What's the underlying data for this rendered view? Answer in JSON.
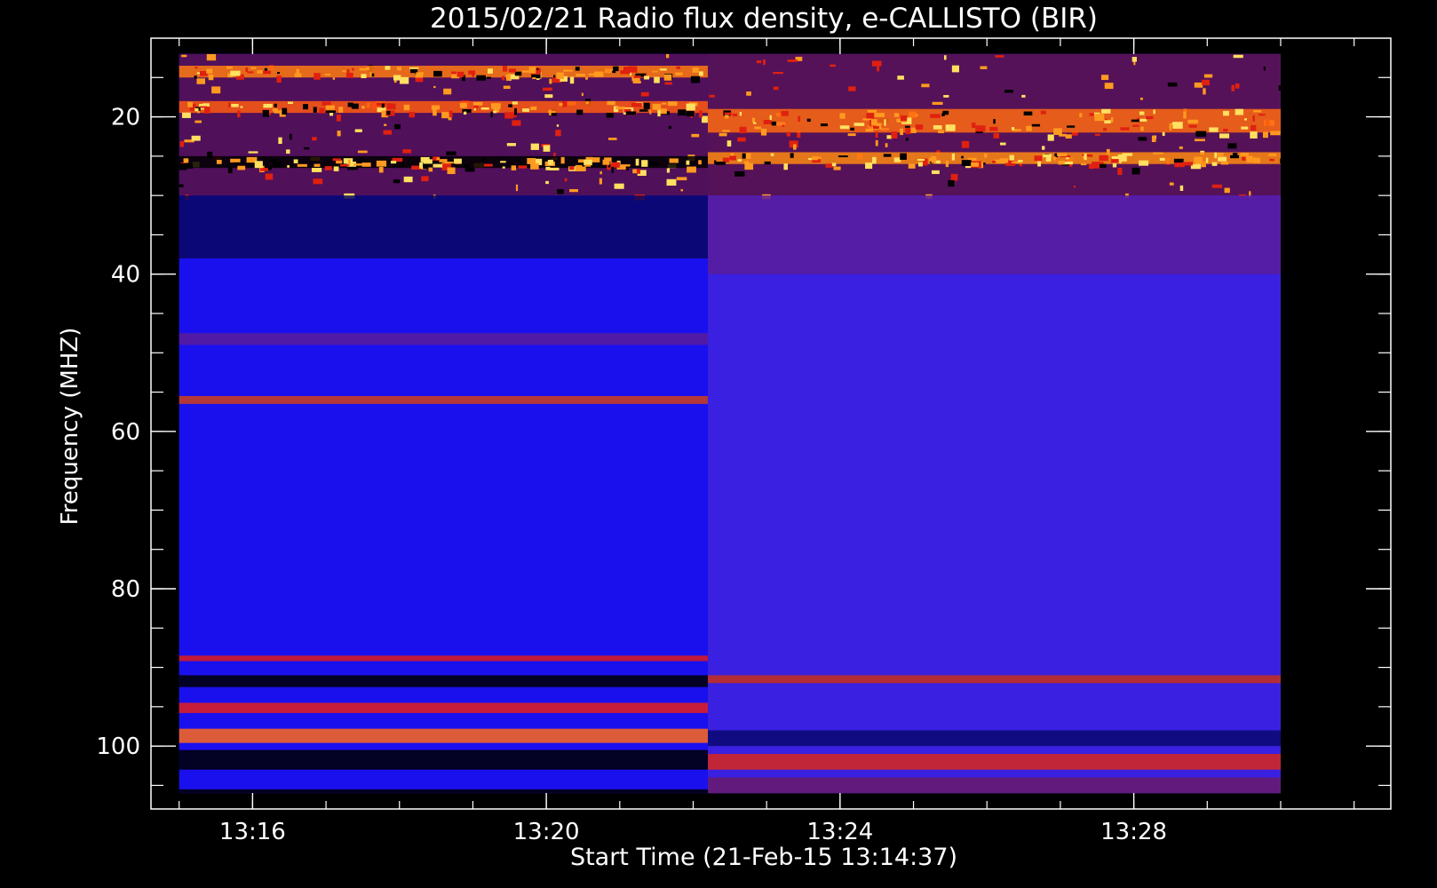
{
  "chart_data": {
    "type": "heatmap",
    "title": "2015/02/21  Radio flux density, e-CALLISTO (BIR)",
    "xlabel": "Start Time (21-Feb-15 13:14:37)",
    "ylabel": "Frequency (MHZ)",
    "x_range": [
      "13:14:37",
      "13:31:30"
    ],
    "y_range": [
      10,
      108
    ],
    "y_inverted": true,
    "data_time_range": [
      "13:15:00",
      "13:30:00"
    ],
    "data_freq_range": [
      12,
      106
    ],
    "x_ticks": [
      {
        "time": "13:16",
        "label": "13:16"
      },
      {
        "time": "13:20",
        "label": "13:20"
      },
      {
        "time": "13:24",
        "label": "13:24"
      },
      {
        "time": "13:28",
        "label": "13:28"
      }
    ],
    "x_minor_step_min": 1,
    "y_ticks": [
      {
        "value": 20,
        "label": "20"
      },
      {
        "value": 40,
        "label": "40"
      },
      {
        "value": 60,
        "label": "60"
      },
      {
        "value": 80,
        "label": "80"
      },
      {
        "value": 100,
        "label": "100"
      }
    ],
    "y_minor_step": 5,
    "switch_time": "13:22:12",
    "segments": [
      {
        "start": "13:15:00",
        "end": "13:22:12",
        "base_color": "#1a10ee",
        "bands": [
          {
            "f0": 12,
            "f1": 30,
            "color": "#5a1040",
            "noise": true
          },
          {
            "f0": 13.5,
            "f1": 15,
            "color": "#ff7a10",
            "noise": true
          },
          {
            "f0": 18,
            "f1": 19.5,
            "color": "#ff5a10",
            "noise": true
          },
          {
            "f0": 25,
            "f1": 26.5,
            "color": "#000000",
            "noise": true
          },
          {
            "f0": 30,
            "f1": 38,
            "color": "#0a0660",
            "noise": false
          },
          {
            "f0": 47.5,
            "f1": 49,
            "color": "#5a1c9a",
            "noise": false
          },
          {
            "f0": 55.5,
            "f1": 56.5,
            "color": "#d0401a",
            "noise": false
          },
          {
            "f0": 88.5,
            "f1": 89.2,
            "color": "#e01a1a",
            "noise": false
          },
          {
            "f0": 91,
            "f1": 92.5,
            "color": "#000000",
            "noise": false
          },
          {
            "f0": 94.5,
            "f1": 95.8,
            "color": "#e8201a",
            "noise": false
          },
          {
            "f0": 97.8,
            "f1": 99.6,
            "color": "#ff6a1a",
            "noise": false
          },
          {
            "f0": 100.5,
            "f1": 103,
            "color": "#000000",
            "noise": false
          },
          {
            "f0": 105.5,
            "f1": 106,
            "color": "#000000",
            "noise": false
          }
        ]
      },
      {
        "start": "13:22:12",
        "end": "13:30:00",
        "base_color": "#3a20e0",
        "bands": [
          {
            "f0": 12,
            "f1": 30,
            "color": "#5a1040",
            "noise": true
          },
          {
            "f0": 19,
            "f1": 22,
            "color": "#ff6a10",
            "noise": true
          },
          {
            "f0": 24.5,
            "f1": 26,
            "color": "#ff8a10",
            "noise": true
          },
          {
            "f0": 30,
            "f1": 40,
            "color": "#5a1c9a",
            "noise": false
          },
          {
            "f0": 91,
            "f1": 92,
            "color": "#c8301a",
            "noise": false
          },
          {
            "f0": 98,
            "f1": 100,
            "color": "#0a0870",
            "noise": false
          },
          {
            "f0": 101,
            "f1": 103,
            "color": "#d8281a",
            "noise": false
          },
          {
            "f0": 104,
            "f1": 106,
            "color": "#6a1a6a",
            "noise": false
          }
        ]
      }
    ],
    "colors": {
      "background": "#000000",
      "axis": "#ffffff",
      "text": "#ffffff"
    }
  }
}
